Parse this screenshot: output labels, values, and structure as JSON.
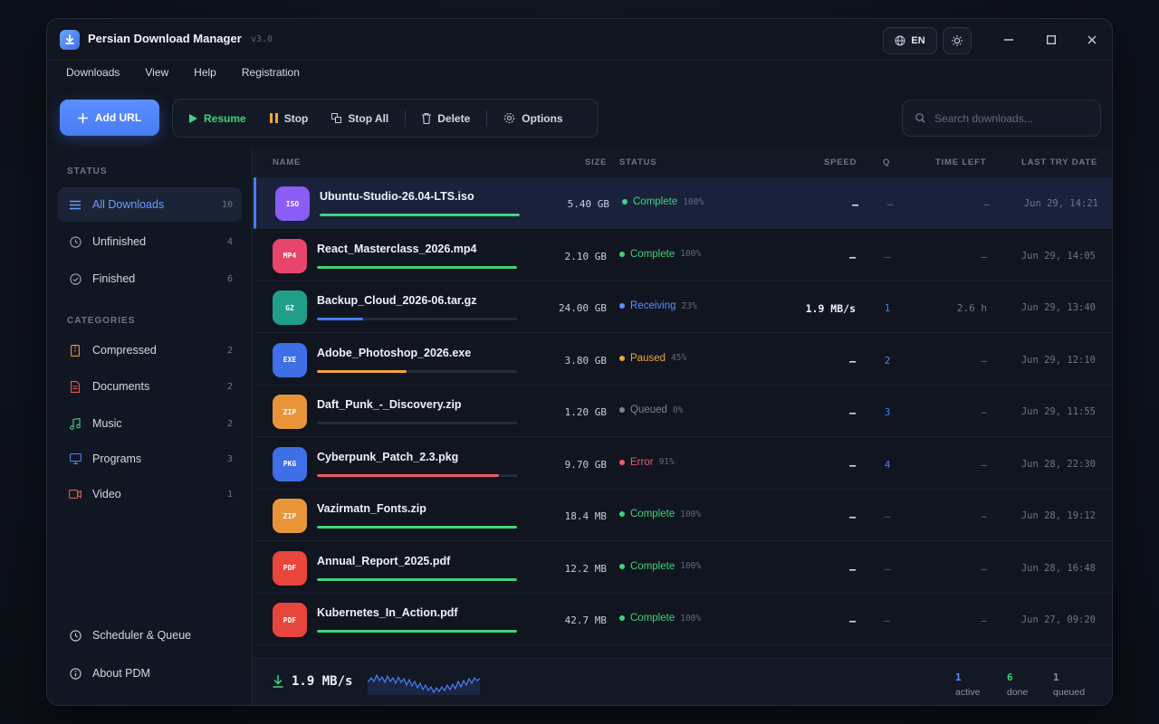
{
  "window": {
    "title": "Persian Download Manager",
    "version": "v3.0",
    "lang": "EN"
  },
  "menu": [
    "Downloads",
    "View",
    "Help",
    "Registration"
  ],
  "toolbar": {
    "add_url": "Add URL",
    "resume": "Resume",
    "stop": "Stop",
    "stop_all": "Stop All",
    "delete": "Delete",
    "options": "Options",
    "search_placeholder": "Search downloads..."
  },
  "sidebar": {
    "status_heading": "STATUS",
    "status_items": [
      {
        "label": "All Downloads",
        "count": "10",
        "icon": "list-icon"
      },
      {
        "label": "Unfinished",
        "count": "4",
        "icon": "clock-icon"
      },
      {
        "label": "Finished",
        "count": "6",
        "icon": "check-circle-icon"
      }
    ],
    "categories_heading": "CATEGORIES",
    "category_items": [
      {
        "label": "Compressed",
        "count": "2",
        "icon": "archive-icon",
        "color": "#e8953a"
      },
      {
        "label": "Documents",
        "count": "2",
        "icon": "document-icon",
        "color": "#e85a4f"
      },
      {
        "label": "Music",
        "count": "2",
        "icon": "music-icon",
        "color": "#3fd37a"
      },
      {
        "label": "Programs",
        "count": "3",
        "icon": "monitor-icon",
        "color": "#4a7cf4"
      },
      {
        "label": "Video",
        "count": "1",
        "icon": "video-icon",
        "color": "#e85a4f"
      }
    ],
    "scheduler": "Scheduler & Queue",
    "about": "About PDM"
  },
  "table": {
    "headers": {
      "name": "NAME",
      "size": "SIZE",
      "status": "STATUS",
      "speed": "SPEED",
      "q": "Q",
      "time_left": "TIME LEFT",
      "last_try": "LAST TRY DATE"
    },
    "rows": [
      {
        "type": "ISO",
        "type_color": "#8b5cf6",
        "name": "Ubuntu-Studio-26.04-LTS.iso",
        "progress": 100,
        "bar_color": "#3fd37a",
        "size": "5.40 GB",
        "status": "Complete",
        "status_color": "#3fd37a",
        "pct": "100%",
        "speed": "—",
        "q": "–",
        "time_left": "–",
        "date": "Jun 29, 14:21"
      },
      {
        "type": "MP4",
        "type_color": "#e8456b",
        "name": "React_Masterclass_2026.mp4",
        "progress": 100,
        "bar_color": "#3fd37a",
        "size": "2.10 GB",
        "status": "Complete",
        "status_color": "#3fd37a",
        "pct": "100%",
        "speed": "—",
        "q": "–",
        "time_left": "–",
        "date": "Jun 29, 14:05"
      },
      {
        "type": "GZ",
        "type_color": "#1f9e8a",
        "name": "Backup_Cloud_2026-06.tar.gz",
        "progress": 23,
        "bar_color": "#4a7cf4",
        "size": "24.00 GB",
        "status": "Receiving",
        "status_color": "#5b8fff",
        "pct": "23%",
        "speed": "1.9 MB/s",
        "q": "1",
        "time_left": "2.6 h",
        "date": "Jun 29, 13:40"
      },
      {
        "type": "EXE",
        "type_color": "#3f6fe6",
        "name": "Adobe_Photoshop_2026.exe",
        "progress": 45,
        "bar_color": "#f0a53a",
        "size": "3.80 GB",
        "status": "Paused",
        "status_color": "#f0a53a",
        "pct": "45%",
        "speed": "—",
        "q": "2",
        "time_left": "–",
        "date": "Jun 29, 12:10"
      },
      {
        "type": "ZIP",
        "type_color": "#e8953a",
        "name": "Daft_Punk_-_Discovery.zip",
        "progress": 0,
        "bar_color": "#4a5568",
        "size": "1.20 GB",
        "status": "Queued",
        "status_color": "#7a8497",
        "pct": "0%",
        "speed": "—",
        "q": "3",
        "time_left": "–",
        "date": "Jun 29, 11:55"
      },
      {
        "type": "PKG",
        "type_color": "#3f6fe6",
        "name": "Cyberpunk_Patch_2.3.pkg",
        "progress": 91,
        "bar_color": "#ef5b6a",
        "size": "9.70 GB",
        "status": "Error",
        "status_color": "#ef5b6a",
        "pct": "91%",
        "speed": "—",
        "q": "4",
        "time_left": "–",
        "date": "Jun 28, 22:30"
      },
      {
        "type": "ZIP",
        "type_color": "#e8953a",
        "name": "Vazirmatn_Fonts.zip",
        "progress": 100,
        "bar_color": "#3fd37a",
        "size": "18.4 MB",
        "status": "Complete",
        "status_color": "#3fd37a",
        "pct": "100%",
        "speed": "—",
        "q": "–",
        "time_left": "–",
        "date": "Jun 28, 19:12"
      },
      {
        "type": "PDF",
        "type_color": "#e8453c",
        "name": "Annual_Report_2025.pdf",
        "progress": 100,
        "bar_color": "#3fd37a",
        "size": "12.2 MB",
        "status": "Complete",
        "status_color": "#3fd37a",
        "pct": "100%",
        "speed": "—",
        "q": "–",
        "time_left": "–",
        "date": "Jun 28, 16:48"
      },
      {
        "type": "PDF",
        "type_color": "#e8453c",
        "name": "Kubernetes_In_Action.pdf",
        "progress": 100,
        "bar_color": "#3fd37a",
        "size": "42.7 MB",
        "status": "Complete",
        "status_color": "#3fd37a",
        "pct": "100%",
        "speed": "—",
        "q": "–",
        "time_left": "–",
        "date": "Jun 27, 09:20"
      }
    ]
  },
  "footer": {
    "speed": "1.9 MB/s",
    "active_count": "1",
    "active_label": "active",
    "done_count": "6",
    "done_label": "done",
    "queued_count": "1",
    "queued_label": "queued"
  }
}
